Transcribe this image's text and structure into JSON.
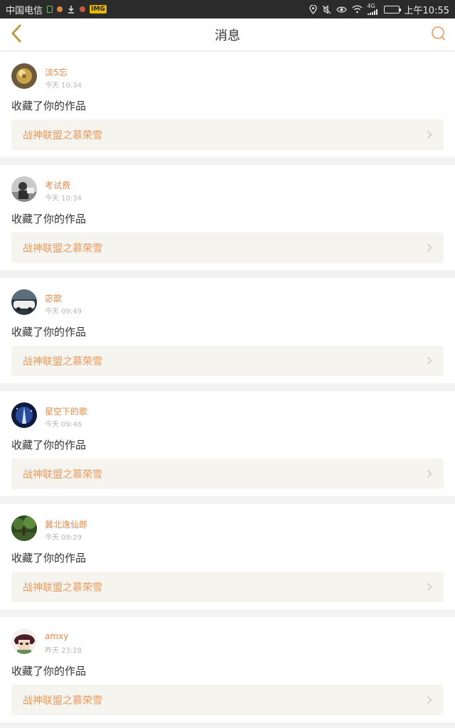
{
  "statusbar": {
    "carrier": "中国电信",
    "time": "上午10:55",
    "signal_label": "4G",
    "battery_level": 0.85,
    "badge_text": "IMG"
  },
  "navbar": {
    "title": "消息"
  },
  "colors": {
    "accent": "#e08b4f",
    "work_text": "#e89a5d",
    "work_bg": "#f6f4ee",
    "back_icon": "#b99d3e"
  },
  "feed": [
    {
      "user": "淡5忘",
      "time": "今天 10:34",
      "action": "收藏了你的作品",
      "work": "战神联盟之慕荣雪",
      "avatar": "gold-ornament"
    },
    {
      "user": "考试费",
      "time": "今天 10:34",
      "action": "收藏了你的作品",
      "work": "战神联盟之慕荣雪",
      "avatar": "gray-figure"
    },
    {
      "user": "宓歆",
      "time": "今天 09:49",
      "action": "收藏了你的作品",
      "work": "战神联盟之慕荣雪",
      "avatar": "white-car"
    },
    {
      "user": "星空下的歌",
      "time": "今天 09:46",
      "action": "收藏了你的作品",
      "work": "战神联盟之慕荣雪",
      "avatar": "blue-night"
    },
    {
      "user": "冀北逸仙郎",
      "time": "今天 09:29",
      "action": "收藏了你的作品",
      "work": "战神联盟之慕荣雪",
      "avatar": "green-forest"
    },
    {
      "user": "amxy",
      "time": "昨天 23:28",
      "action": "收藏了你的作品",
      "work": "战神联盟之慕荣雪",
      "avatar": "anime-character"
    }
  ]
}
